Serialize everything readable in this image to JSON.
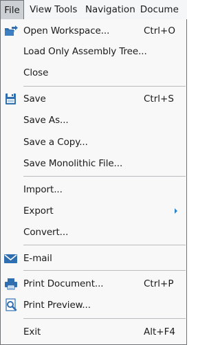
{
  "menubar": {
    "file": "File",
    "view": "View",
    "tools": "Tools",
    "navigation": "Navigation",
    "document": "Docume"
  },
  "menu": {
    "open_workspace": {
      "label": "Open Workspace...",
      "shortcut": "Ctrl+O",
      "icon": "open-folder-arrow-icon"
    },
    "load_tree": {
      "label": "Load Only Assembly Tree..."
    },
    "close": {
      "label": "Close"
    },
    "save": {
      "label": "Save",
      "shortcut": "Ctrl+S",
      "icon": "floppy-disk-icon"
    },
    "save_as": {
      "label": "Save As..."
    },
    "save_copy": {
      "label": "Save a Copy..."
    },
    "save_mono": {
      "label": "Save Monolithic File..."
    },
    "import": {
      "label": "Import..."
    },
    "export": {
      "label": "Export",
      "has_submenu": true
    },
    "convert": {
      "label": "Convert..."
    },
    "email": {
      "label": "E-mail",
      "icon": "envelope-icon"
    },
    "print": {
      "label": "Print Document...",
      "shortcut": "Ctrl+P",
      "icon": "printer-icon"
    },
    "preview": {
      "label": "Print Preview...",
      "icon": "print-preview-icon"
    },
    "exit": {
      "label": "Exit",
      "shortcut": "Alt+F4"
    }
  },
  "colors": {
    "icon_blue": "#2f6fb0",
    "icon_light": "#6ea7da",
    "menubar_bg": "#f5f6f7",
    "menu_bg": "#f8f8f8",
    "separator": "#b8babd",
    "selected_tab_bg": "#ccd0d4"
  }
}
